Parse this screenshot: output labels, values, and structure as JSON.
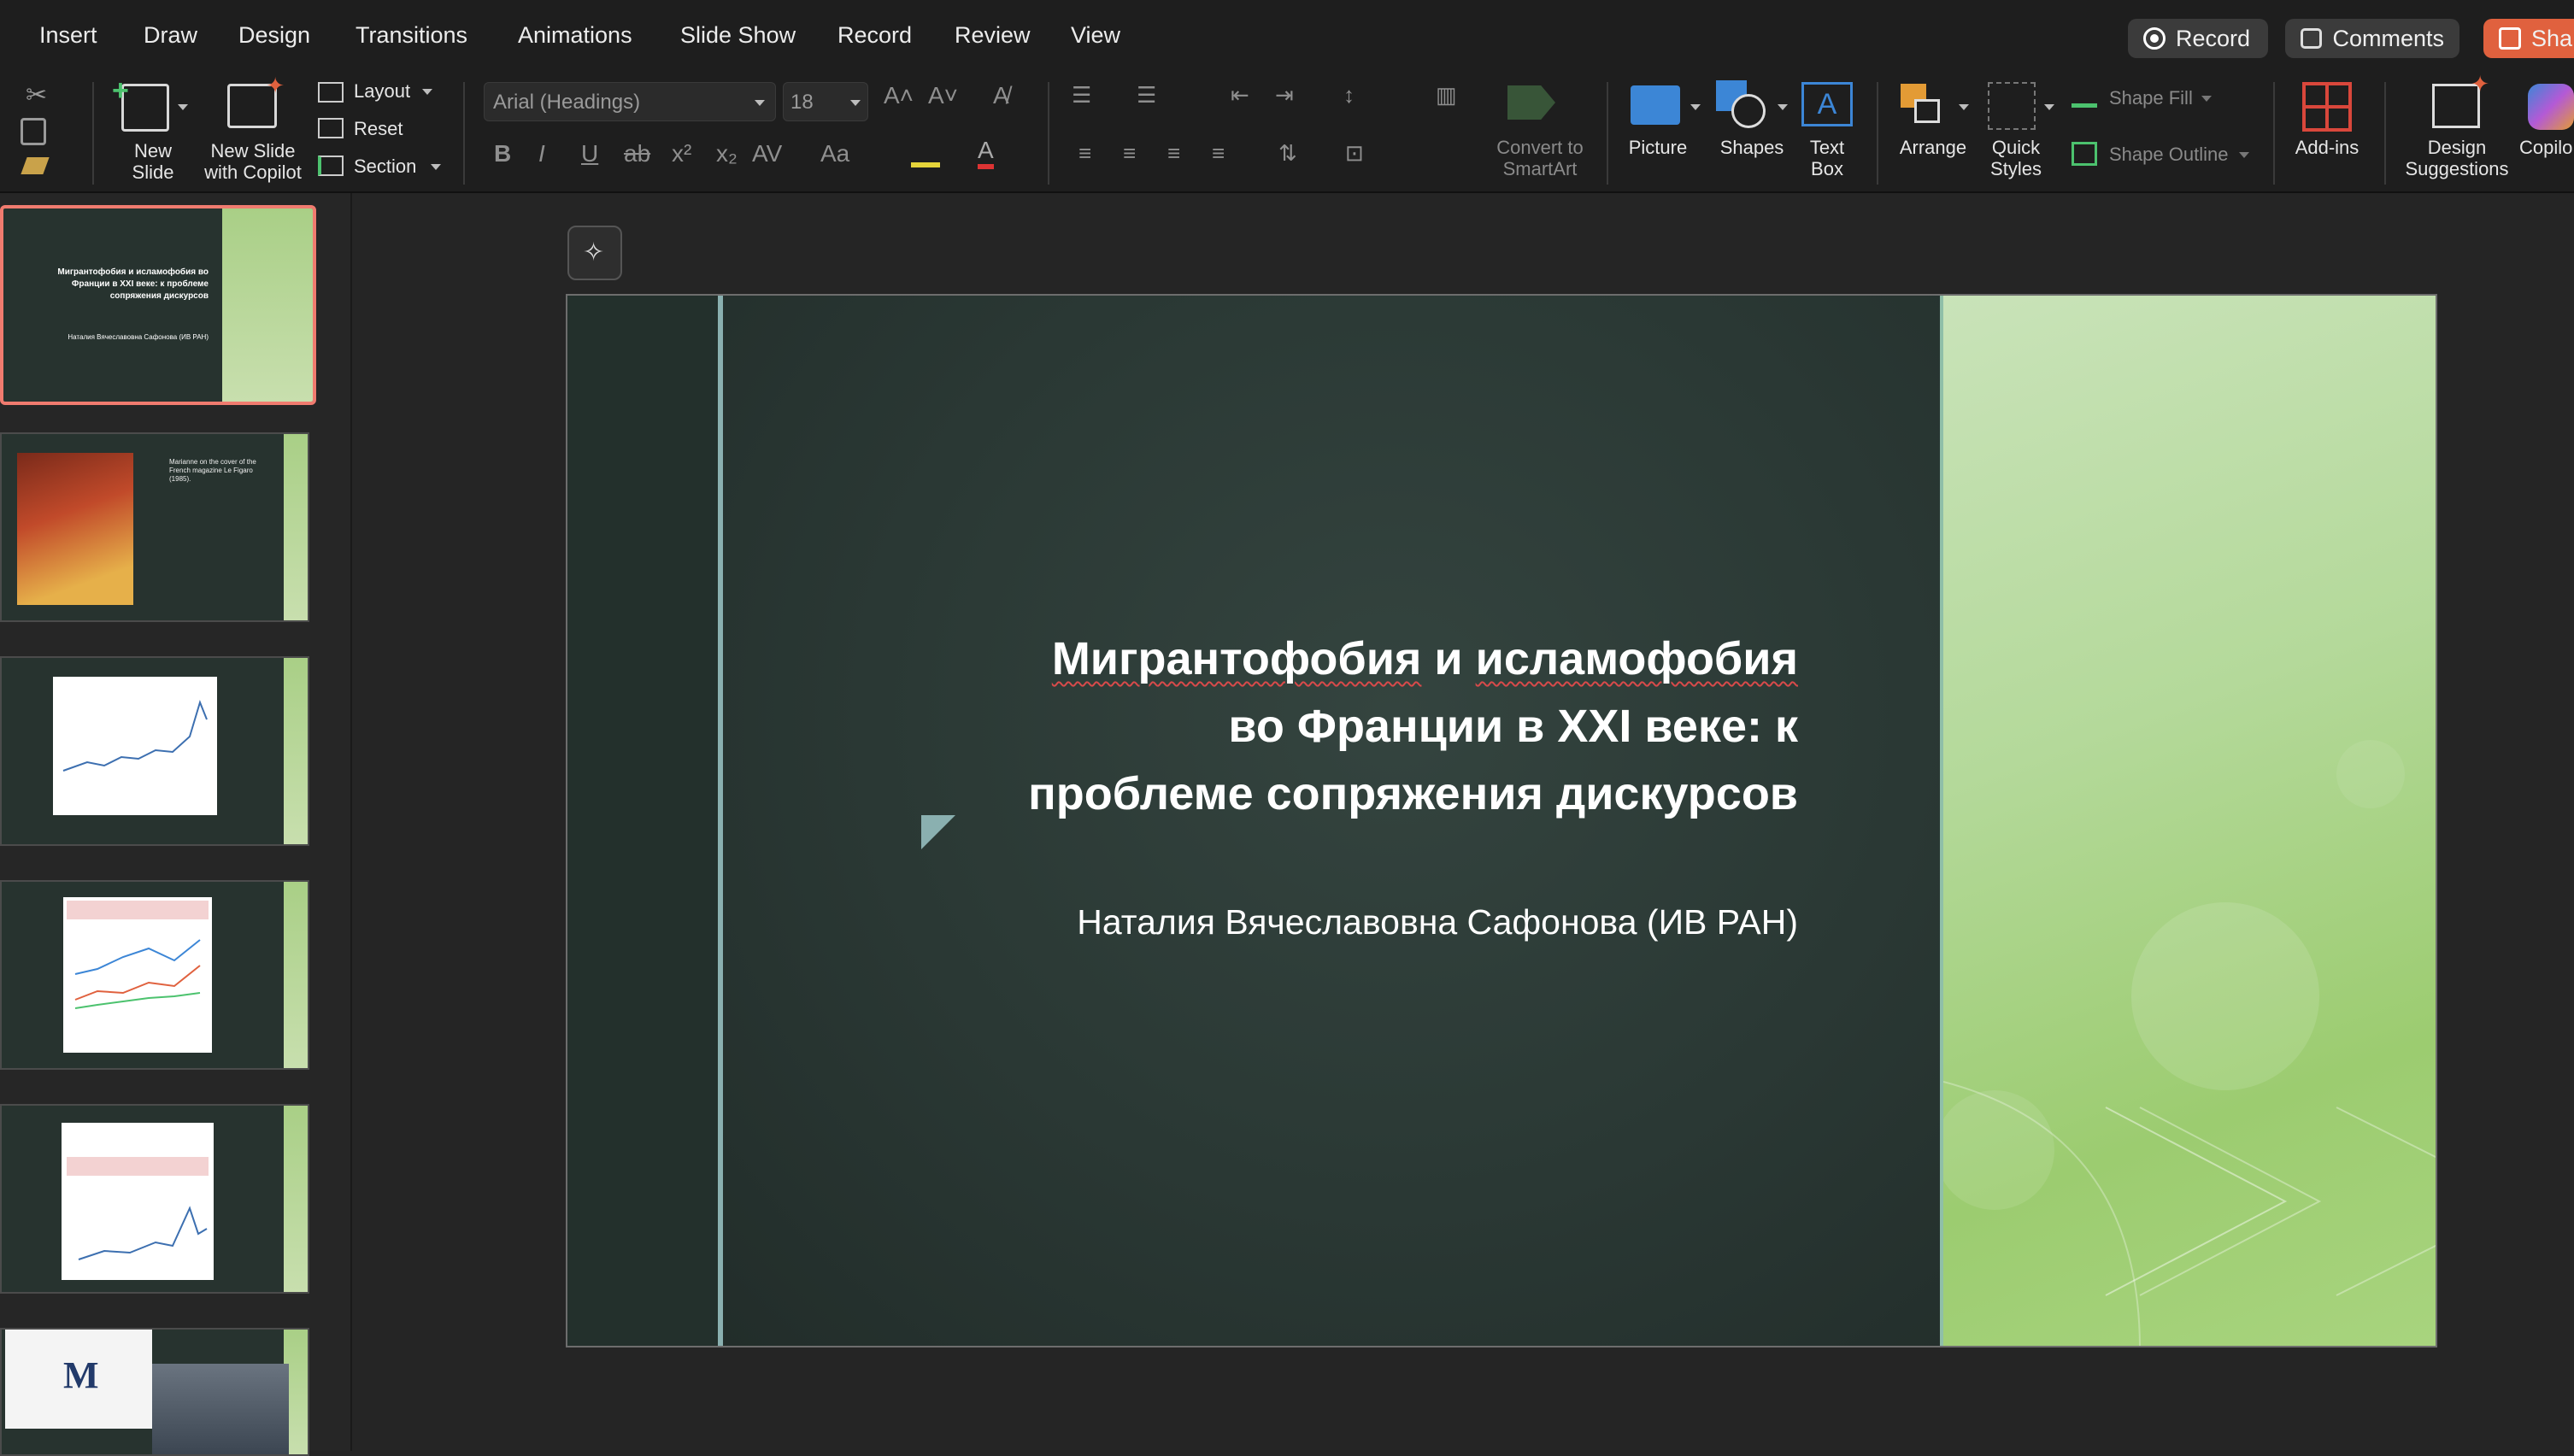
{
  "menu": {
    "items": [
      "Insert",
      "Draw",
      "Design",
      "Transitions",
      "Animations",
      "Slide Show",
      "Record",
      "Review",
      "View"
    ],
    "record_button": "Record",
    "comments_button": "Comments",
    "share_button": "Sha"
  },
  "ribbon": {
    "new_slide": "New Slide",
    "new_slide_copilot": "New Slide with Copilot",
    "layout": "Layout",
    "reset": "Reset",
    "section": "Section",
    "font_name": "Arial (Headings)",
    "font_size": "18",
    "convert_smartart": "Convert to SmartArt",
    "picture": "Picture",
    "shapes": "Shapes",
    "text_box": "Text Box",
    "arrange": "Arrange",
    "quick_styles": "Quick Styles",
    "shape_fill": "Shape Fill",
    "shape_outline": "Shape Outline",
    "add_ins": "Add-ins",
    "design_suggestions": "Design Suggestions",
    "copilot": "Copilo"
  },
  "thumbnails": {
    "slide1_title": "Мигрантофобия и исламофобия во Франции в XXI веке: к проблеме сопряжения дискурсов",
    "slide1_author": "Наталия Вячеславовна Сафонова (ИВ РАН)",
    "slide2_caption": "Marianne on the cover of the French magazine Le Figaro (1985)."
  },
  "slide": {
    "title_line1_a": "Мигрантофобия",
    "title_line1_b": " и ",
    "title_line1_c": "исламофобия",
    "title_line2": "во Франции в XXI веке: к",
    "title_line3": "проблеме сопряжения дискурсов",
    "subtitle": "Наталия Вячеславовна Сафонова (ИВ РАН)"
  },
  "colors": {
    "accent_record": "#e0613e",
    "selection_border": "#f07b6f",
    "slide_bg": "#283632",
    "slide_green": "#a8d47e"
  }
}
